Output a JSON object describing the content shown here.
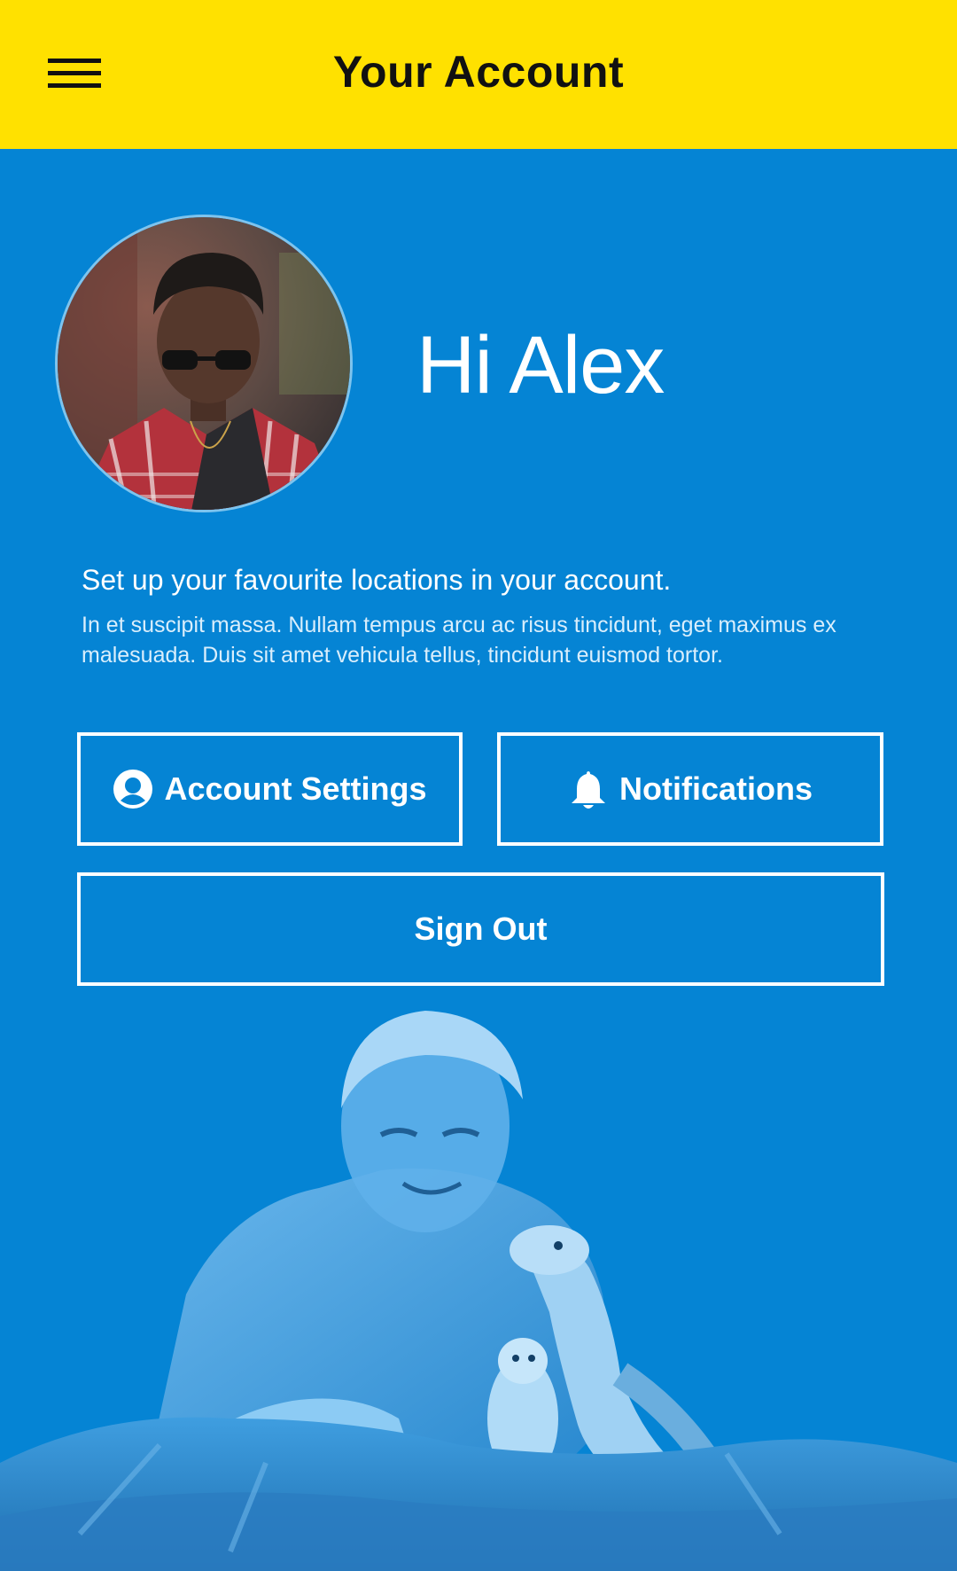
{
  "header": {
    "title": "Your Account",
    "menu_icon": "hamburger-menu-icon"
  },
  "profile": {
    "greeting": "Hi Alex",
    "avatar_icon": "profile-photo"
  },
  "intro": {
    "title": "Set up your favourite locations in your account.",
    "body": "In et suscipit massa. Nullam tempus arcu ac risus tincidunt, eget maximus ex malesuada. Duis sit amet vehicula tellus, tincidunt euismod tortor."
  },
  "actions": {
    "account_settings": {
      "label": "Account Settings",
      "icon": "account-icon"
    },
    "notifications": {
      "label": "Notifications",
      "icon": "bell-icon"
    },
    "sign_out": {
      "label": "Sign Out"
    }
  },
  "colors": {
    "header_bg": "#ffe100",
    "page_bg": "#0584d4",
    "text_light": "#ffffff"
  }
}
